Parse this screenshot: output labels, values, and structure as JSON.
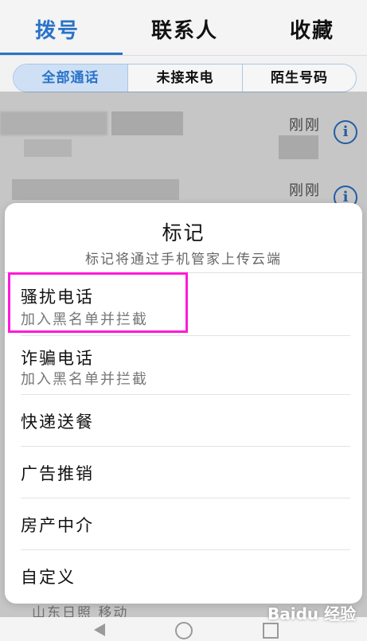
{
  "tabs": [
    {
      "label": "拨号",
      "active": true
    },
    {
      "label": "联系人",
      "active": false
    },
    {
      "label": "收藏",
      "active": false
    }
  ],
  "filters": [
    {
      "label": "全部通话",
      "active": true
    },
    {
      "label": "未接来电",
      "active": false
    },
    {
      "label": "陌生号码",
      "active": false
    }
  ],
  "calls": [
    {
      "time": "刚刚"
    },
    {
      "time": "刚刚"
    },
    {
      "location": "山东日照 移动"
    }
  ],
  "sheet": {
    "title": "标记",
    "subtitle": "标记将通过手机管家上传云端",
    "options": [
      {
        "label": "骚扰电话",
        "sub": "加入黑名单并拦截"
      },
      {
        "label": "诈骗电话",
        "sub": "加入黑名单并拦截"
      },
      {
        "label": "快递送餐"
      },
      {
        "label": "广告推销"
      },
      {
        "label": "房产中介"
      },
      {
        "label": "自定义"
      }
    ]
  },
  "watermark": "Baidu 经验",
  "colors": {
    "accent": "#2a73c9",
    "highlight": "#ff1ad9"
  }
}
